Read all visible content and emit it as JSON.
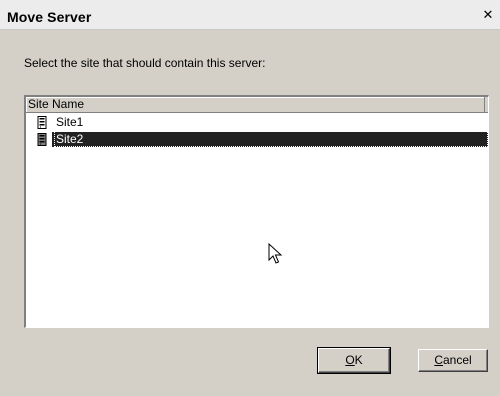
{
  "window": {
    "title": "Move Server",
    "close_glyph": "✕"
  },
  "instruction": "Select the site that should contain this server:",
  "list": {
    "columns": [
      "Site Name"
    ],
    "rows": [
      {
        "label": "Site1",
        "icon": "server-icon",
        "selected": false
      },
      {
        "label": "Site2",
        "icon": "server-icon",
        "selected": true
      }
    ]
  },
  "buttons": {
    "ok": {
      "mnemonic": "O",
      "rest": "K"
    },
    "cancel": {
      "mnemonic": "C",
      "rest": "ancel"
    }
  },
  "colors": {
    "dialog_bg": "#d4d0c8",
    "selection_bg": "#222222",
    "selection_text": "#ffffff"
  }
}
